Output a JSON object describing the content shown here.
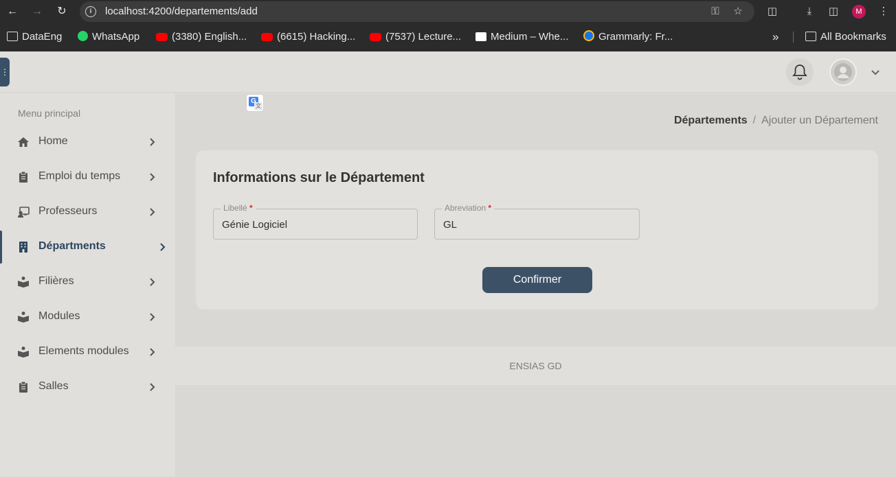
{
  "browser": {
    "url": "localhost:4200/departements/add",
    "profile_initial": "M",
    "bookmarks": [
      {
        "label": "DataEng",
        "icon": "folder-icon"
      },
      {
        "label": "WhatsApp",
        "icon": "whatsapp-icon"
      },
      {
        "label": "(3380) English...",
        "icon": "youtube-icon"
      },
      {
        "label": "(6615) Hacking...",
        "icon": "youtube-icon"
      },
      {
        "label": "(7537) Lecture...",
        "icon": "youtube-icon"
      },
      {
        "label": "Medium – Whe...",
        "icon": "medium-icon"
      },
      {
        "label": "Grammarly: Fr...",
        "icon": "grammarly-icon"
      }
    ],
    "overflow": "»",
    "all_bookmarks": "All Bookmarks"
  },
  "sidebar": {
    "title": "Menu principal",
    "items": [
      {
        "label": "Home",
        "icon": "home-icon"
      },
      {
        "label": "Emploi du temps",
        "icon": "clipboard-icon"
      },
      {
        "label": "Professeurs",
        "icon": "teacher-icon"
      },
      {
        "label": "Départments",
        "icon": "building-icon"
      },
      {
        "label": "Filières",
        "icon": "book-reader-icon"
      },
      {
        "label": "Modules",
        "icon": "book-reader-icon"
      },
      {
        "label": "Elements modules",
        "icon": "book-reader-icon"
      },
      {
        "label": "Salles",
        "icon": "clipboard-icon"
      }
    ],
    "active_index": 3
  },
  "breadcrumb": {
    "parent": "Départements",
    "separator": "/",
    "current": "Ajouter un Département"
  },
  "form": {
    "title": "Informations sur le Département",
    "libelle_label": "Libellé",
    "libelle_value": "Génie Logiciel",
    "abreviation_label": "Abreviation",
    "abreviation_value": "GL",
    "required_mark": "*",
    "submit_label": "Confirmer"
  },
  "footer": {
    "text": "ENSIAS GD"
  },
  "colors": {
    "accent": "#3d5166",
    "required": "#d32f2f"
  }
}
